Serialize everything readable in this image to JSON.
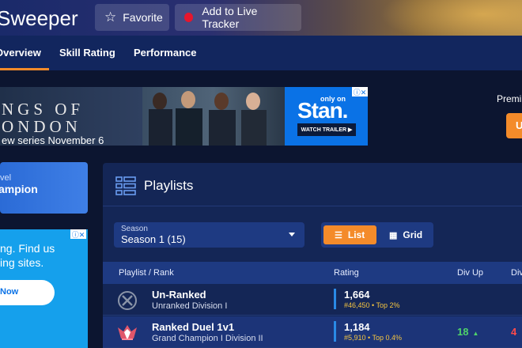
{
  "header": {
    "player_name": "Sweeper",
    "favorite_label": "Favorite",
    "tracker_label": "Add to Live Tracker"
  },
  "nav": {
    "tabs": [
      {
        "label": "Overview"
      },
      {
        "label": "Skill Rating"
      },
      {
        "label": "Performance"
      }
    ],
    "active": "Overview"
  },
  "ad_banner": {
    "line1": "NGS OF",
    "line2": "ONDON",
    "line3": "ew series November 6",
    "only_on": "only on",
    "brand": "Stan.",
    "cta": "WATCH TRAILER ▶"
  },
  "premium": {
    "text": "Premi",
    "button": "U"
  },
  "level_card": {
    "label": "vel",
    "value": "ampion"
  },
  "side_ad": {
    "line1": "ng. Find us",
    "line2": "ing sites.",
    "button": "Now"
  },
  "playlists": {
    "title": "Playlists",
    "season_label": "Season",
    "season_value": "Season 1 (15)",
    "view_list": "List",
    "view_grid": "Grid",
    "columns": [
      "Playlist / Rank",
      "Rating",
      "Div Up",
      "Div"
    ],
    "rows": [
      {
        "name": "Un-Ranked",
        "division": "Unranked Division I",
        "rating": "1,664",
        "rating_sub": "#46,450 • Top 2%",
        "div_up": "",
        "div_down": ""
      },
      {
        "name": "Ranked Duel 1v1",
        "division": "Grand Champion I Division II",
        "rating": "1,184",
        "rating_sub": "#5,910 • Top 0.4%",
        "div_up": "18",
        "div_down": "4"
      }
    ]
  },
  "colors": {
    "accent": "#f48b2a",
    "nav_bg": "#12265e",
    "page_bg": "#0c1530",
    "div_up": "#4fd36a",
    "div_down": "#ff4a4a"
  }
}
